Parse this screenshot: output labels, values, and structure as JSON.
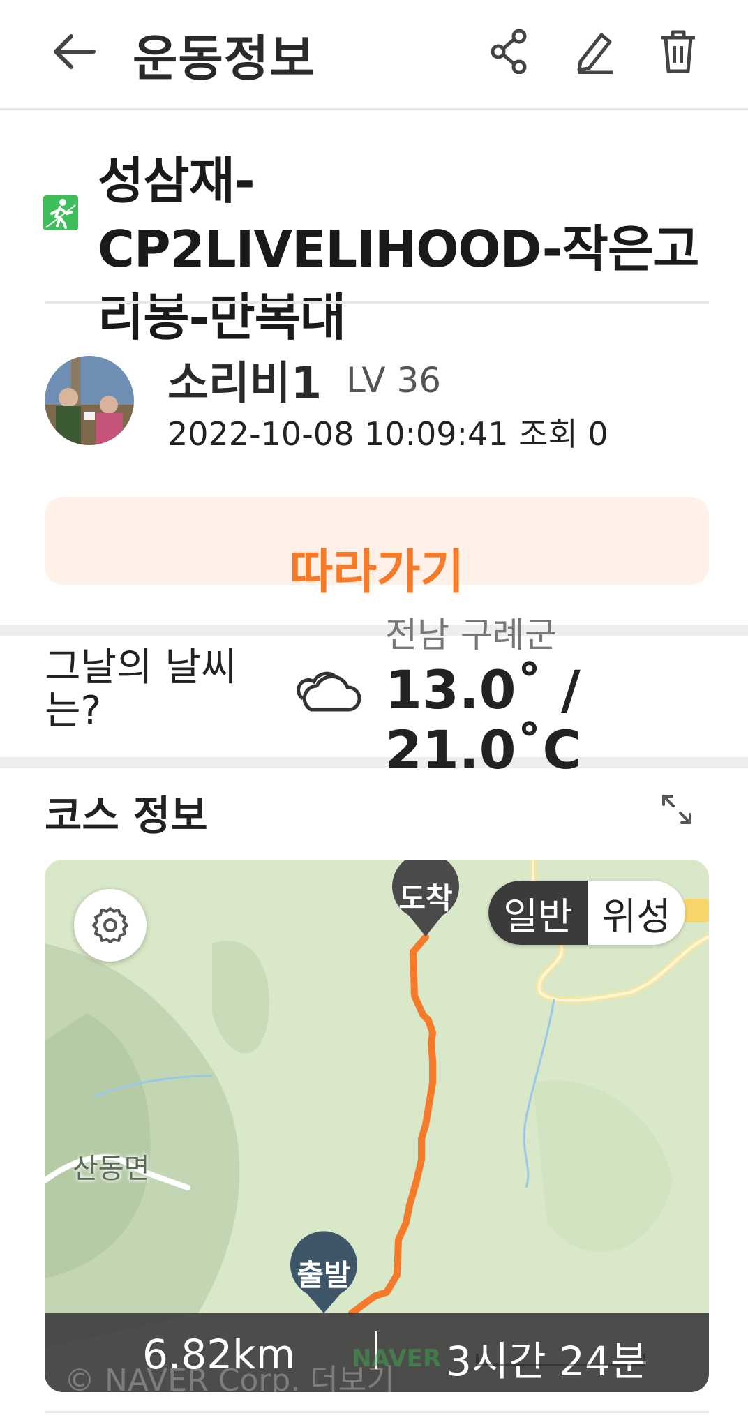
{
  "header": {
    "title": "운동정보",
    "back_icon": "arrow-left-icon",
    "share_icon": "share-icon",
    "edit_icon": "pencil-icon",
    "delete_icon": "trash-icon"
  },
  "course": {
    "title": "성삼재-CP2LIVELIHOOD-작은고리봉-만복대",
    "activity_icon": "hiking-icon",
    "activity_color": "#3ebd5b"
  },
  "user": {
    "name": "소리비1",
    "level": "LV 36",
    "meta": "2022-10-08 10:09:41 조회 0"
  },
  "follow": {
    "label": "따라가기",
    "color": "#f57b2a",
    "bg": "#fff0e8"
  },
  "weather": {
    "question": "그날의 날씨는?",
    "location": "전남 구례군",
    "temperature": "13.0˚ / 21.0˚C",
    "icon": "cloud-icon"
  },
  "course_info": {
    "title": "코스 정보",
    "expand_icon": "expand-icon"
  },
  "map": {
    "settings_icon": "gear-icon",
    "toggle_normal": "일반",
    "toggle_satellite": "위성",
    "pin_end": "도착",
    "pin_start": "출발",
    "town": "산동면",
    "route_color": "#f57b2a",
    "distance": "6.82km",
    "duration": "3시간 24분",
    "credit": "© NAVER Corp. 더보기",
    "logo": "NAVER"
  }
}
